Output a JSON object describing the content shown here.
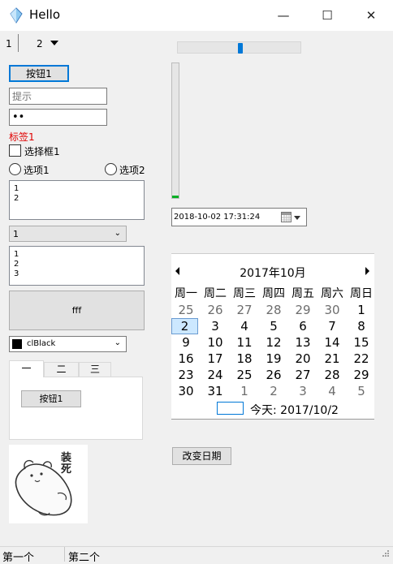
{
  "window": {
    "title": "Hello",
    "minimize_glyph": "—",
    "maximize_glyph": "☐",
    "close_glyph": "✕"
  },
  "top_tabs": [
    {
      "label": "1"
    },
    {
      "label": "2"
    }
  ],
  "button1": "按钮1",
  "edit_placeholder": "提示",
  "password_value": "••",
  "label1": "标签1",
  "checkbox_label": "选择框1",
  "radio1_label": "选项1",
  "radio2_label": "选项2",
  "memo_lines": [
    "1",
    "2"
  ],
  "combo_value": "1",
  "list_items": [
    "1",
    "2",
    "3"
  ],
  "big_button": "fff",
  "color_combo": {
    "value": "clBlack",
    "swatch": "#000000"
  },
  "page_tabs": [
    {
      "label": "一"
    },
    {
      "label": "二"
    },
    {
      "label": "三"
    }
  ],
  "tab_button": "按钮1",
  "trackbar_h": {
    "value_fraction": 0.5
  },
  "progress_v": {
    "value_fraction": 0.02,
    "color": "#06b025"
  },
  "datetime_picker": "2018-10-02 17:31:24",
  "calendar": {
    "month_label": "2017年10月",
    "weekdays": [
      "周一",
      "周二",
      "周三",
      "周四",
      "周五",
      "周六",
      "周日"
    ],
    "weeks": [
      [
        "25",
        "26",
        "27",
        "28",
        "29",
        "30",
        "1"
      ],
      [
        "2",
        "3",
        "4",
        "5",
        "6",
        "7",
        "8"
      ],
      [
        "9",
        "10",
        "11",
        "12",
        "13",
        "14",
        "15"
      ],
      [
        "16",
        "17",
        "18",
        "19",
        "20",
        "21",
        "22"
      ],
      [
        "23",
        "24",
        "25",
        "26",
        "27",
        "28",
        "29"
      ],
      [
        "30",
        "31",
        "1",
        "2",
        "3",
        "4",
        "5"
      ]
    ],
    "today_label": "今天: 2017/10/2",
    "selected": "2"
  },
  "change_date_button": "改变日期",
  "image_caption": "装死",
  "status": [
    {
      "text": "第一个"
    },
    {
      "text": "第二个"
    }
  ],
  "accent": "#0078d7"
}
